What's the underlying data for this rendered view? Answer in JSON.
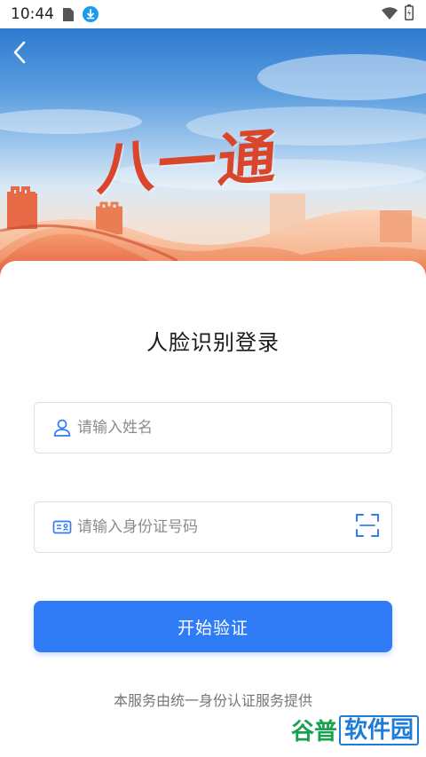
{
  "status_bar": {
    "time": "10:44",
    "icons": [
      "sim-card-icon",
      "download-icon",
      "wifi-icon",
      "battery-icon"
    ]
  },
  "header": {
    "back_icon": "chevron-left-icon",
    "banner_title": "八一通"
  },
  "login": {
    "title": "人脸识别登录",
    "name_field": {
      "value": "",
      "placeholder": "请输入姓名",
      "icon": "user-icon"
    },
    "id_field": {
      "value": "",
      "placeholder": "请输入身份证号码",
      "icon": "id-card-icon",
      "scan_icon": "scan-icon"
    },
    "submit_label": "开始验证",
    "footer_note": "本服务由统一身份认证服务提供"
  },
  "watermark": {
    "part1": "谷普",
    "part2": "软件园"
  },
  "colors": {
    "accent": "#2f7cf6",
    "banner_title": "#d9462b",
    "icon_blue": "#2f7cf6",
    "watermark_green": "#18a14e",
    "watermark_blue": "#1e7bd6"
  }
}
